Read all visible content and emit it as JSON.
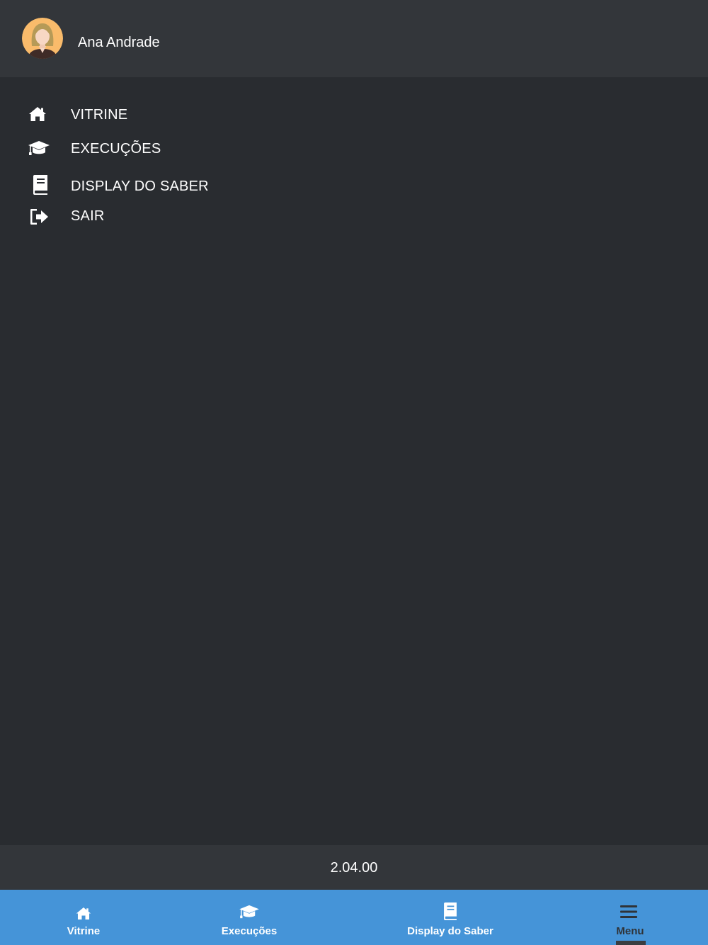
{
  "header": {
    "user_name": "Ana Andrade",
    "avatar_icon": "female-avatar-icon"
  },
  "menu": {
    "items": [
      {
        "label": "VITRINE",
        "icon": "home-icon"
      },
      {
        "label": "EXECUÇÕES",
        "icon": "graduation-cap-icon"
      },
      {
        "label": "DISPLAY DO SABER",
        "icon": "book-icon"
      },
      {
        "label": "SAIR",
        "icon": "sign-out-icon"
      }
    ]
  },
  "footer": {
    "version": "2.04.00"
  },
  "tabbar": {
    "tabs": [
      {
        "label": "Vitrine",
        "icon": "home-icon"
      },
      {
        "label": "Execuções",
        "icon": "graduation-cap-icon"
      },
      {
        "label": "Display do Saber",
        "icon": "book-icon"
      },
      {
        "label": "Menu",
        "icon": "hamburger-menu-icon",
        "active": true
      }
    ]
  },
  "colors": {
    "background": "#292c30",
    "header_bg": "#33363a",
    "tabbar_bg": "#4594d8",
    "active_tab_text": "#2f3338"
  }
}
